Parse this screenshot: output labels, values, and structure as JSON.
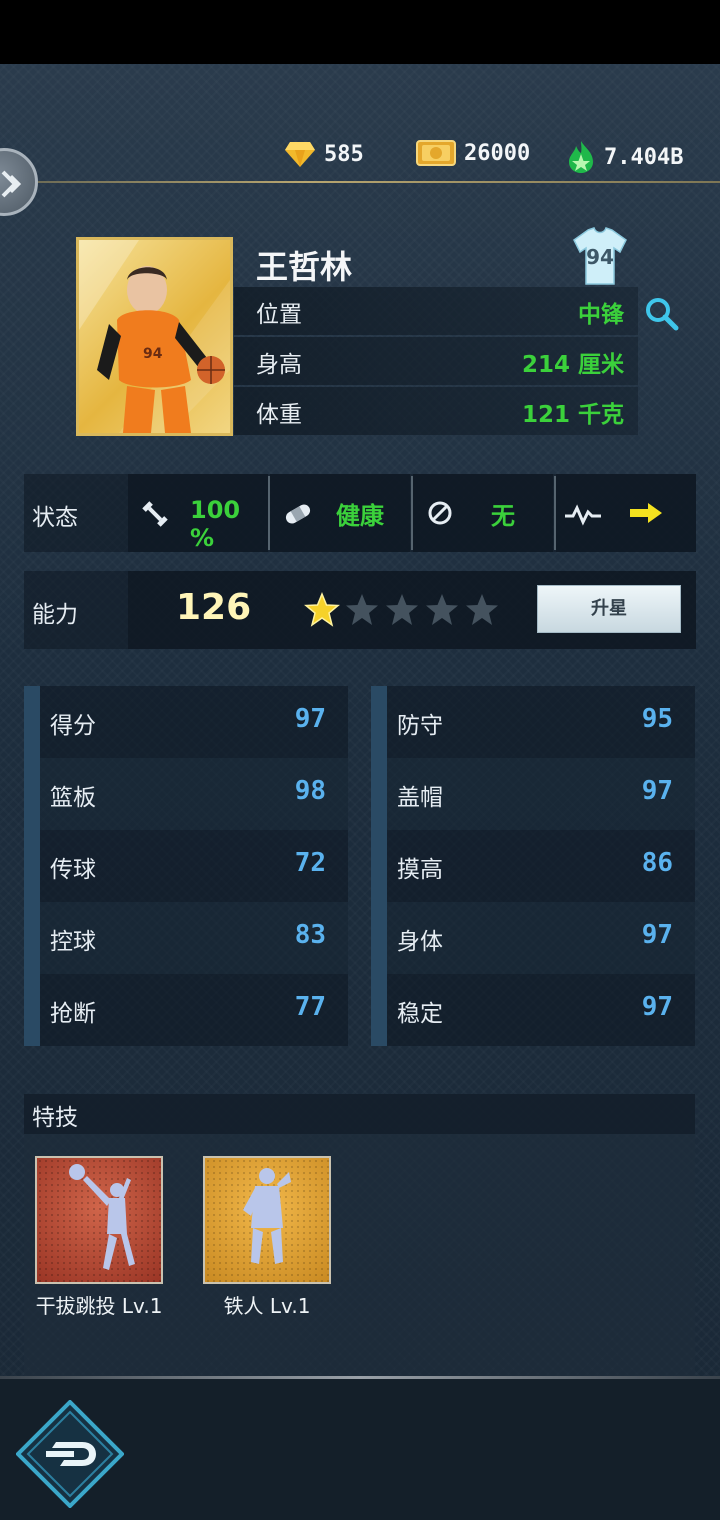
{
  "currency": {
    "diamonds": "585",
    "coins": "26000",
    "power": "7.404B"
  },
  "player": {
    "name": "王哲林",
    "jersey_number": "94",
    "info": [
      {
        "label": "位置",
        "value": "中锋"
      },
      {
        "label": "身高",
        "value": "214 厘米"
      },
      {
        "label": "体重",
        "value": "121 千克"
      }
    ]
  },
  "status": {
    "label": "状态",
    "stamina": "100 %",
    "health": "健康",
    "injury": "无"
  },
  "ability": {
    "label": "能力",
    "value": "126",
    "stars_filled": 1,
    "stars_total": 5,
    "upgrade_label": "升星"
  },
  "stats_left": [
    {
      "label": "得分",
      "value": "97"
    },
    {
      "label": "篮板",
      "value": "98"
    },
    {
      "label": "传球",
      "value": "72"
    },
    {
      "label": "控球",
      "value": "83"
    },
    {
      "label": "抢断",
      "value": "77"
    }
  ],
  "stats_right": [
    {
      "label": "防守",
      "value": "95"
    },
    {
      "label": "盖帽",
      "value": "97"
    },
    {
      "label": "摸高",
      "value": "86"
    },
    {
      "label": "身体",
      "value": "97"
    },
    {
      "label": "稳定",
      "value": "97"
    }
  ],
  "skills": {
    "title": "特技",
    "items": [
      {
        "name": "干拔跳投 Lv.1",
        "color": "#c0543a"
      },
      {
        "name": "铁人 Lv.1",
        "color": "#e0a23a"
      }
    ]
  },
  "colors": {
    "green_value": "#3bd13b",
    "stat_blue": "#5ab2ee",
    "gold": "#d9b85b"
  }
}
